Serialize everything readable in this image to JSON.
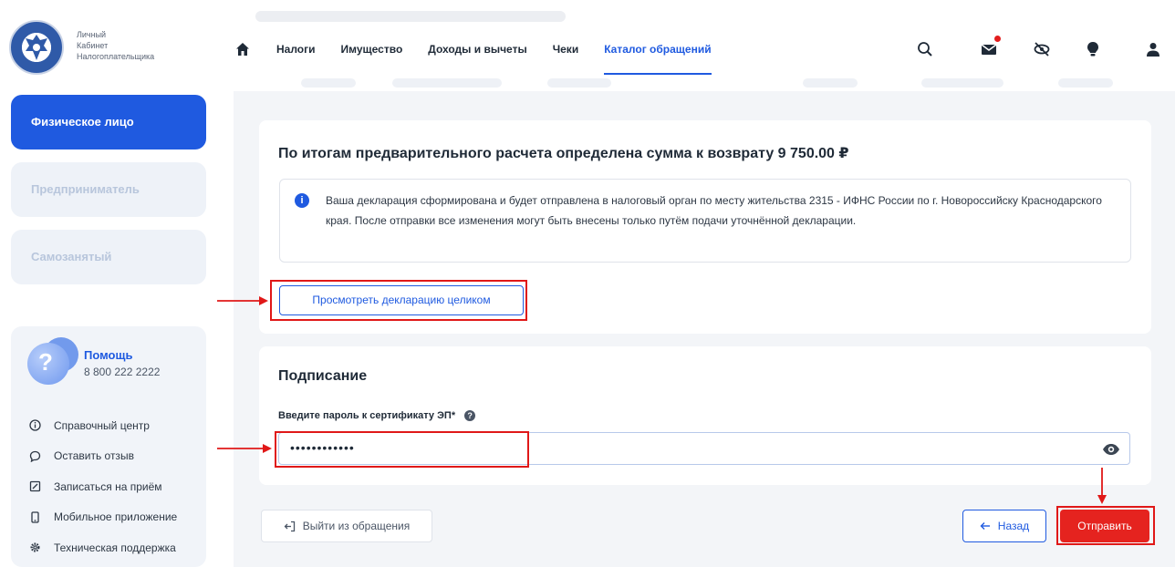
{
  "logo": {
    "line1": "Личный",
    "line2": "Кабинет",
    "line3": "Налогоплательщика"
  },
  "nav": {
    "items": [
      {
        "label": "Налоги"
      },
      {
        "label": "Имущество"
      },
      {
        "label": "Доходы и вычеты"
      },
      {
        "label": "Чеки"
      },
      {
        "label": "Каталог обращений"
      }
    ],
    "active_index": 4
  },
  "header_icons": [
    "search-icon",
    "mail-icon",
    "eye-off-icon",
    "lightbulb-icon",
    "user-icon"
  ],
  "sidebar": {
    "roles": [
      {
        "label": "Физическое лицо",
        "active": true
      },
      {
        "label": "Предприниматель",
        "active": false
      },
      {
        "label": "Самозанятый",
        "active": false
      }
    ],
    "help": {
      "title": "Помощь",
      "phone": "8 800 222 2222",
      "links": [
        {
          "label": "Справочный центр",
          "icon": "info-circle-icon"
        },
        {
          "label": "Оставить отзыв",
          "icon": "chat-bubble-icon"
        },
        {
          "label": "Записаться на приём",
          "icon": "edit-calendar-icon"
        },
        {
          "label": "Мобильное приложение",
          "icon": "phone-icon"
        },
        {
          "label": "Техническая поддержка",
          "icon": "gear-icon"
        }
      ]
    }
  },
  "result": {
    "title": "По итогам предварительного расчета определена сумма к возврату 9 750.00 ₽",
    "info_text": "Ваша декларация сформирована и будет отправлена в налоговый орган по месту жительства 2315 - ИФНС России по г. Новороссийску Краснодарского края. После отправки все изменения могут быть внесены только путём подачи уточнённой декларации.",
    "view_button": "Просмотреть декларацию целиком"
  },
  "signing": {
    "title": "Подписание",
    "password_label": "Введите пароль к сертификату ЭП*",
    "password_value": "••••••••••••"
  },
  "actions": {
    "exit": "Выйти из обращения",
    "back": "Назад",
    "send": "Отправить"
  },
  "colors": {
    "accent": "#1f5ae0",
    "danger": "#e5231f",
    "annotation": "#e01818"
  }
}
